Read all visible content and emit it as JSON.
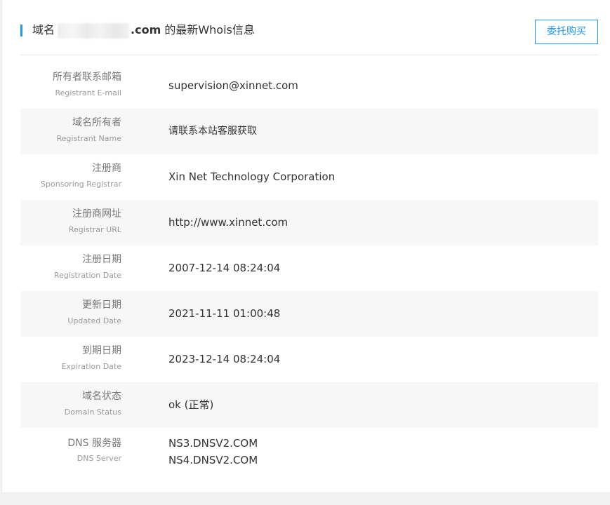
{
  "header": {
    "prefix": "域名",
    "domain_suffix": ".com",
    "suffix_text": " 的最新Whois信息",
    "entrust_button": "委托购买"
  },
  "rows": [
    {
      "label_cn": "所有者联系邮箱",
      "label_en": "Registrant E-mail",
      "value": "supervision@xinnet.com"
    },
    {
      "label_cn": "域名所有者",
      "label_en": "Registrant Name",
      "value": "请联系本站客服获取"
    },
    {
      "label_cn": "注册商",
      "label_en": "Sponsoring Registrar",
      "value": "Xin Net Technology Corporation"
    },
    {
      "label_cn": "注册商网址",
      "label_en": "Registrar URL",
      "value": "http://www.xinnet.com"
    },
    {
      "label_cn": "注册日期",
      "label_en": "Registration Date",
      "value": "2007-12-14 08:24:04"
    },
    {
      "label_cn": "更新日期",
      "label_en": "Updated Date",
      "value": "2021-11-11 01:00:48"
    },
    {
      "label_cn": "到期日期",
      "label_en": "Expiration Date",
      "value": "2023-12-14 08:24:04"
    },
    {
      "label_cn": "域名状态",
      "label_en": "Domain Status",
      "value": "ok (正常)"
    },
    {
      "label_cn": "DNS 服务器",
      "label_en": "DNS Server",
      "values": [
        "NS3.DNSV2.COM",
        "NS4.DNSV2.COM"
      ]
    }
  ],
  "colors": {
    "accent": "#2196f3",
    "row_alt_bg": "#f7f7f7",
    "page_bg": "#f2f2f2"
  }
}
